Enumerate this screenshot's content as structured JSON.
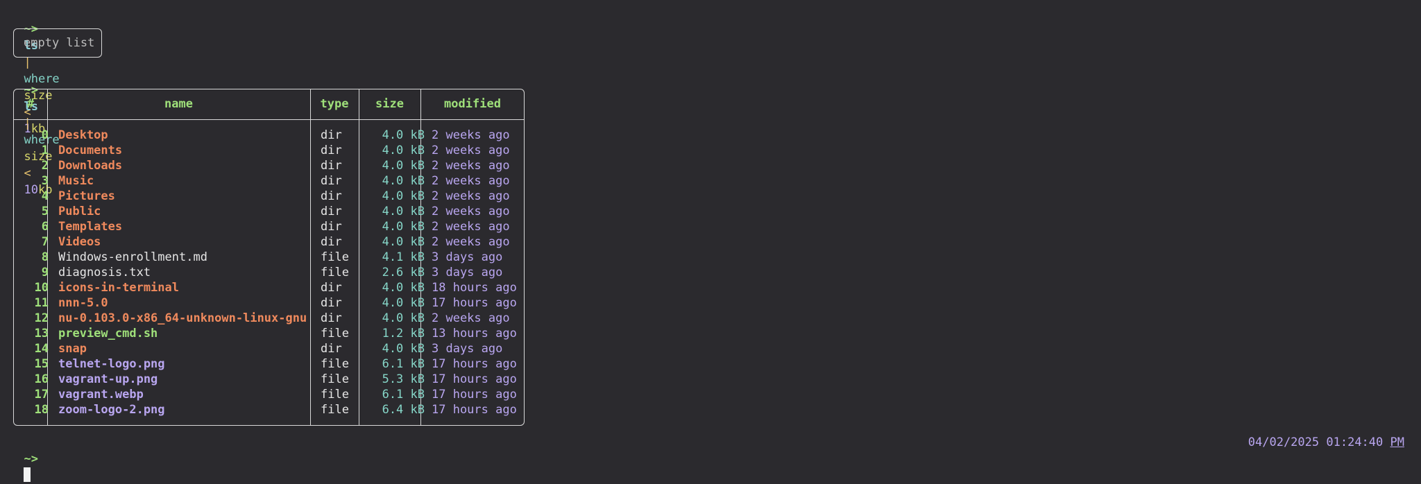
{
  "commands": [
    {
      "prompt": "~>",
      "cmd": "ls",
      "pipe": "|",
      "keyword": "where",
      "field": "size",
      "op": "<",
      "num": "1",
      "unit": "kb"
    },
    {
      "prompt": "~>",
      "cmd": "ls",
      "pipe": "|",
      "keyword": "where",
      "field": "size",
      "op": "<",
      "num": "10",
      "unit": "kb"
    }
  ],
  "empty_result": "empty list",
  "table": {
    "headers": [
      "#",
      "name",
      "type",
      "size",
      "modified"
    ],
    "rows": [
      {
        "idx": "0",
        "name": "Desktop",
        "kind": "dir",
        "type": "dir",
        "size": "4.0 kB",
        "modified": "2 weeks ago"
      },
      {
        "idx": "1",
        "name": "Documents",
        "kind": "dir",
        "type": "dir",
        "size": "4.0 kB",
        "modified": "2 weeks ago"
      },
      {
        "idx": "2",
        "name": "Downloads",
        "kind": "dir",
        "type": "dir",
        "size": "4.0 kB",
        "modified": "2 weeks ago"
      },
      {
        "idx": "3",
        "name": "Music",
        "kind": "dir",
        "type": "dir",
        "size": "4.0 kB",
        "modified": "2 weeks ago"
      },
      {
        "idx": "4",
        "name": "Pictures",
        "kind": "dir",
        "type": "dir",
        "size": "4.0 kB",
        "modified": "2 weeks ago"
      },
      {
        "idx": "5",
        "name": "Public",
        "kind": "dir",
        "type": "dir",
        "size": "4.0 kB",
        "modified": "2 weeks ago"
      },
      {
        "idx": "6",
        "name": "Templates",
        "kind": "dir",
        "type": "dir",
        "size": "4.0 kB",
        "modified": "2 weeks ago"
      },
      {
        "idx": "7",
        "name": "Videos",
        "kind": "dir",
        "type": "dir",
        "size": "4.0 kB",
        "modified": "2 weeks ago"
      },
      {
        "idx": "8",
        "name": "Windows-enrollment.md",
        "kind": "file",
        "type": "file",
        "size": "4.1 kB",
        "modified": "3 days ago"
      },
      {
        "idx": "9",
        "name": "diagnosis.txt",
        "kind": "file",
        "type": "file",
        "size": "2.6 kB",
        "modified": "3 days ago"
      },
      {
        "idx": "10",
        "name": "icons-in-terminal",
        "kind": "dir",
        "type": "dir",
        "size": "4.0 kB",
        "modified": "18 hours ago"
      },
      {
        "idx": "11",
        "name": "nnn-5.0",
        "kind": "dir",
        "type": "dir",
        "size": "4.0 kB",
        "modified": "17 hours ago"
      },
      {
        "idx": "12",
        "name": "nu-0.103.0-x86_64-unknown-linux-gnu",
        "kind": "dir",
        "type": "dir",
        "size": "4.0 kB",
        "modified": "2 weeks ago"
      },
      {
        "idx": "13",
        "name": "preview_cmd.sh",
        "kind": "exec",
        "type": "file",
        "size": "1.2 kB",
        "modified": "13 hours ago"
      },
      {
        "idx": "14",
        "name": "snap",
        "kind": "dir",
        "type": "dir",
        "size": "4.0 kB",
        "modified": "3 days ago"
      },
      {
        "idx": "15",
        "name": "telnet-logo.png",
        "kind": "img",
        "type": "file",
        "size": "6.1 kB",
        "modified": "17 hours ago"
      },
      {
        "idx": "16",
        "name": "vagrant-up.png",
        "kind": "img",
        "type": "file",
        "size": "5.3 kB",
        "modified": "17 hours ago"
      },
      {
        "idx": "17",
        "name": "vagrant.webp",
        "kind": "img",
        "type": "file",
        "size": "6.1 kB",
        "modified": "17 hours ago"
      },
      {
        "idx": "18",
        "name": "zoom-logo-2.png",
        "kind": "img",
        "type": "file",
        "size": "6.4 kB",
        "modified": "17 hours ago"
      }
    ]
  },
  "input_prompt": "~>",
  "clock": {
    "date": "04/02/2025",
    "time": "01:24:40",
    "ampm": "PM"
  },
  "colors": {
    "background": "#2b2a2e",
    "prompt": "#9fe07a",
    "dir_name": "#f08a5d",
    "image_name": "#b9a6f0",
    "size": "#86d6c8"
  }
}
